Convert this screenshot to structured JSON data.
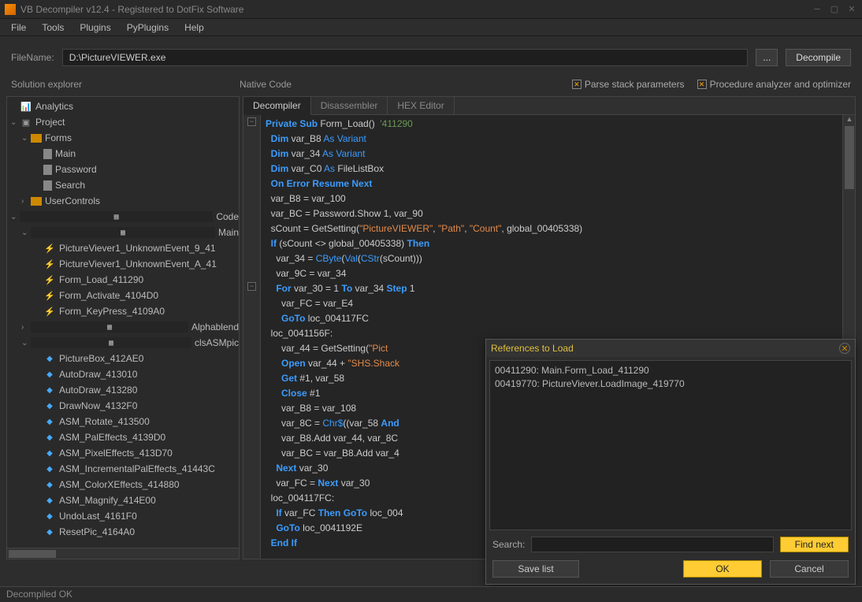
{
  "window": {
    "title": "VB Decompiler v12.4 - Registered to DotFix Software"
  },
  "menu": [
    "File",
    "Tools",
    "Plugins",
    "PyPlugins",
    "Help"
  ],
  "filebar": {
    "label": "FileName:",
    "value": "D:\\PictureVIEWER.exe",
    "browse": "...",
    "decompile": "Decompile"
  },
  "sections": {
    "solution": "Solution explorer",
    "native": "Native Code",
    "chk_parse": "Parse stack parameters",
    "chk_proc": "Procedure analyzer and optimizer"
  },
  "tree": [
    {
      "indent": 0,
      "arrow": "",
      "icon": "analytics",
      "label": "Analytics"
    },
    {
      "indent": 0,
      "arrow": "v",
      "icon": "project",
      "label": "Project"
    },
    {
      "indent": 1,
      "arrow": "v",
      "icon": "folder",
      "label": "Forms"
    },
    {
      "indent": 2,
      "arrow": "",
      "icon": "file",
      "label": "Main"
    },
    {
      "indent": 2,
      "arrow": "",
      "icon": "file",
      "label": "Password"
    },
    {
      "indent": 2,
      "arrow": "",
      "icon": "file",
      "label": "Search"
    },
    {
      "indent": 1,
      "arrow": ">",
      "icon": "folder",
      "label": "UserControls"
    },
    {
      "indent": 0,
      "arrow": "v",
      "icon": "code",
      "label": "Code"
    },
    {
      "indent": 1,
      "arrow": "v",
      "icon": "code",
      "label": "Main"
    },
    {
      "indent": 2,
      "arrow": "",
      "icon": "bolt",
      "label": "PictureViever1_UnknownEvent_9_41"
    },
    {
      "indent": 2,
      "arrow": "",
      "icon": "bolt",
      "label": "PictureViever1_UnknownEvent_A_41"
    },
    {
      "indent": 2,
      "arrow": "",
      "icon": "bolt",
      "label": "Form_Load_411290"
    },
    {
      "indent": 2,
      "arrow": "",
      "icon": "bolt",
      "label": "Form_Activate_4104D0"
    },
    {
      "indent": 2,
      "arrow": "",
      "icon": "bolt",
      "label": "Form_KeyPress_4109A0"
    },
    {
      "indent": 1,
      "arrow": ">",
      "icon": "code",
      "label": "Alphablend"
    },
    {
      "indent": 1,
      "arrow": "v",
      "icon": "code",
      "label": "clsASMpic"
    },
    {
      "indent": 2,
      "arrow": "",
      "icon": "method",
      "label": "PictureBox_412AE0"
    },
    {
      "indent": 2,
      "arrow": "",
      "icon": "method",
      "label": "AutoDraw_413010"
    },
    {
      "indent": 2,
      "arrow": "",
      "icon": "method",
      "label": "AutoDraw_413280"
    },
    {
      "indent": 2,
      "arrow": "",
      "icon": "method",
      "label": "DrawNow_4132F0"
    },
    {
      "indent": 2,
      "arrow": "",
      "icon": "method",
      "label": "ASM_Rotate_413500"
    },
    {
      "indent": 2,
      "arrow": "",
      "icon": "method",
      "label": "ASM_PalEffects_4139D0"
    },
    {
      "indent": 2,
      "arrow": "",
      "icon": "method",
      "label": "ASM_PixelEffects_413D70"
    },
    {
      "indent": 2,
      "arrow": "",
      "icon": "method",
      "label": "ASM_IncrementalPalEffects_41443C"
    },
    {
      "indent": 2,
      "arrow": "",
      "icon": "method",
      "label": "ASM_ColorXEffects_414880"
    },
    {
      "indent": 2,
      "arrow": "",
      "icon": "method",
      "label": "ASM_Magnify_414E00"
    },
    {
      "indent": 2,
      "arrow": "",
      "icon": "method",
      "label": "UndoLast_4161F0"
    },
    {
      "indent": 2,
      "arrow": "",
      "icon": "method",
      "label": "ResetPic_4164A0"
    }
  ],
  "tabs": {
    "decompiler": "Decompiler",
    "disassembler": "Disassembler",
    "hex": "HEX Editor"
  },
  "dialog": {
    "title": "References to Load",
    "items": [
      "00411290: Main.Form_Load_411290",
      "00419770: PictureViever.LoadImage_419770"
    ],
    "search_label": "Search:",
    "find": "Find next",
    "save": "Save list",
    "ok": "OK",
    "cancel": "Cancel"
  },
  "status": "Decompiled OK",
  "code_lines": [
    {
      "indent": 0,
      "parts": [
        {
          "t": "Private Sub",
          "c": "kw"
        },
        {
          "t": " Form_Load()  "
        },
        {
          "t": "'411290",
          "c": "cm"
        }
      ]
    },
    {
      "indent": 1,
      "parts": [
        {
          "t": "Dim",
          "c": "kw"
        },
        {
          "t": " var_B8 "
        },
        {
          "t": "As Variant",
          "c": "type"
        }
      ]
    },
    {
      "indent": 1,
      "parts": [
        {
          "t": "Dim",
          "c": "kw"
        },
        {
          "t": " var_34 "
        },
        {
          "t": "As Variant",
          "c": "type"
        }
      ]
    },
    {
      "indent": 1,
      "parts": [
        {
          "t": "Dim",
          "c": "kw"
        },
        {
          "t": " var_C0 "
        },
        {
          "t": "As",
          "c": "type"
        },
        {
          "t": " FileListBox"
        }
      ]
    },
    {
      "indent": 1,
      "parts": [
        {
          "t": "On Error Resume Next",
          "c": "kw"
        }
      ]
    },
    {
      "indent": 1,
      "parts": [
        {
          "t": "var_B8 = var_100"
        }
      ]
    },
    {
      "indent": 1,
      "parts": [
        {
          "t": "var_BC = Password.Show 1, var_90"
        }
      ]
    },
    {
      "indent": 1,
      "parts": [
        {
          "t": "sCount = GetSetting("
        },
        {
          "t": "\"PictureVIEWER\"",
          "c": "str"
        },
        {
          "t": ", "
        },
        {
          "t": "\"Path\"",
          "c": "str"
        },
        {
          "t": ", "
        },
        {
          "t": "\"Count\"",
          "c": "str"
        },
        {
          "t": ", global_00405338)"
        }
      ]
    },
    {
      "indent": 1,
      "parts": [
        {
          "t": "If",
          "c": "kw"
        },
        {
          "t": " (sCount <> global_00405338) "
        },
        {
          "t": "Then",
          "c": "kw"
        }
      ]
    },
    {
      "indent": 2,
      "parts": [
        {
          "t": "var_34 = "
        },
        {
          "t": "CByte",
          "c": "fn"
        },
        {
          "t": "("
        },
        {
          "t": "Val",
          "c": "fn"
        },
        {
          "t": "("
        },
        {
          "t": "CStr",
          "c": "fn"
        },
        {
          "t": "(sCount)))"
        }
      ]
    },
    {
      "indent": 2,
      "parts": [
        {
          "t": "var_9C = var_34"
        }
      ]
    },
    {
      "indent": 2,
      "parts": [
        {
          "t": "For",
          "c": "kw"
        },
        {
          "t": " var_30 = 1 "
        },
        {
          "t": "To",
          "c": "kw"
        },
        {
          "t": " var_34 "
        },
        {
          "t": "Step",
          "c": "kw"
        },
        {
          "t": " 1"
        }
      ]
    },
    {
      "indent": 3,
      "parts": [
        {
          "t": "var_FC = var_E4"
        }
      ]
    },
    {
      "indent": 3,
      "parts": [
        {
          "t": "GoTo",
          "c": "kw"
        },
        {
          "t": " loc_004117FC"
        }
      ]
    },
    {
      "indent": 1,
      "parts": [
        {
          "t": "loc_0041156F:"
        }
      ]
    },
    {
      "indent": 3,
      "parts": [
        {
          "t": "var_44 = GetSetting("
        },
        {
          "t": "\"Pict",
          "c": "str"
        }
      ]
    },
    {
      "indent": 3,
      "parts": [
        {
          "t": "Open",
          "c": "kw"
        },
        {
          "t": " var_44 + "
        },
        {
          "t": "\"SHS.Shack",
          "c": "str"
        }
      ]
    },
    {
      "indent": 3,
      "parts": [
        {
          "t": "Get",
          "c": "kw"
        },
        {
          "t": " #1, var_58"
        }
      ]
    },
    {
      "indent": 3,
      "parts": [
        {
          "t": "Close",
          "c": "kw"
        },
        {
          "t": " #1"
        }
      ]
    },
    {
      "indent": 3,
      "parts": [
        {
          "t": "var_B8 = var_108"
        }
      ]
    },
    {
      "indent": 3,
      "parts": [
        {
          "t": "var_8C = "
        },
        {
          "t": "Chr$",
          "c": "fn"
        },
        {
          "t": "((var_58 "
        },
        {
          "t": "And",
          "c": "kw"
        }
      ]
    },
    {
      "indent": 3,
      "parts": [
        {
          "t": "var_B8.Add var_44, var_8C"
        }
      ]
    },
    {
      "indent": 3,
      "parts": [
        {
          "t": "var_BC = var_B8.Add var_4"
        }
      ]
    },
    {
      "indent": 2,
      "parts": [
        {
          "t": "Next",
          "c": "kw"
        },
        {
          "t": " var_30"
        }
      ]
    },
    {
      "indent": 2,
      "parts": [
        {
          "t": "var_FC = "
        },
        {
          "t": "Next",
          "c": "kw"
        },
        {
          "t": " var_30"
        }
      ]
    },
    {
      "indent": 1,
      "parts": [
        {
          "t": "loc_004117FC:"
        }
      ]
    },
    {
      "indent": 2,
      "parts": [
        {
          "t": "If",
          "c": "kw"
        },
        {
          "t": " var_FC "
        },
        {
          "t": "Then GoTo",
          "c": "kw"
        },
        {
          "t": " loc_004"
        }
      ]
    },
    {
      "indent": 2,
      "parts": [
        {
          "t": "GoTo",
          "c": "kw"
        },
        {
          "t": " loc_0041192E"
        }
      ]
    },
    {
      "indent": 1,
      "parts": [
        {
          "t": "End If",
          "c": "kw"
        }
      ]
    }
  ]
}
